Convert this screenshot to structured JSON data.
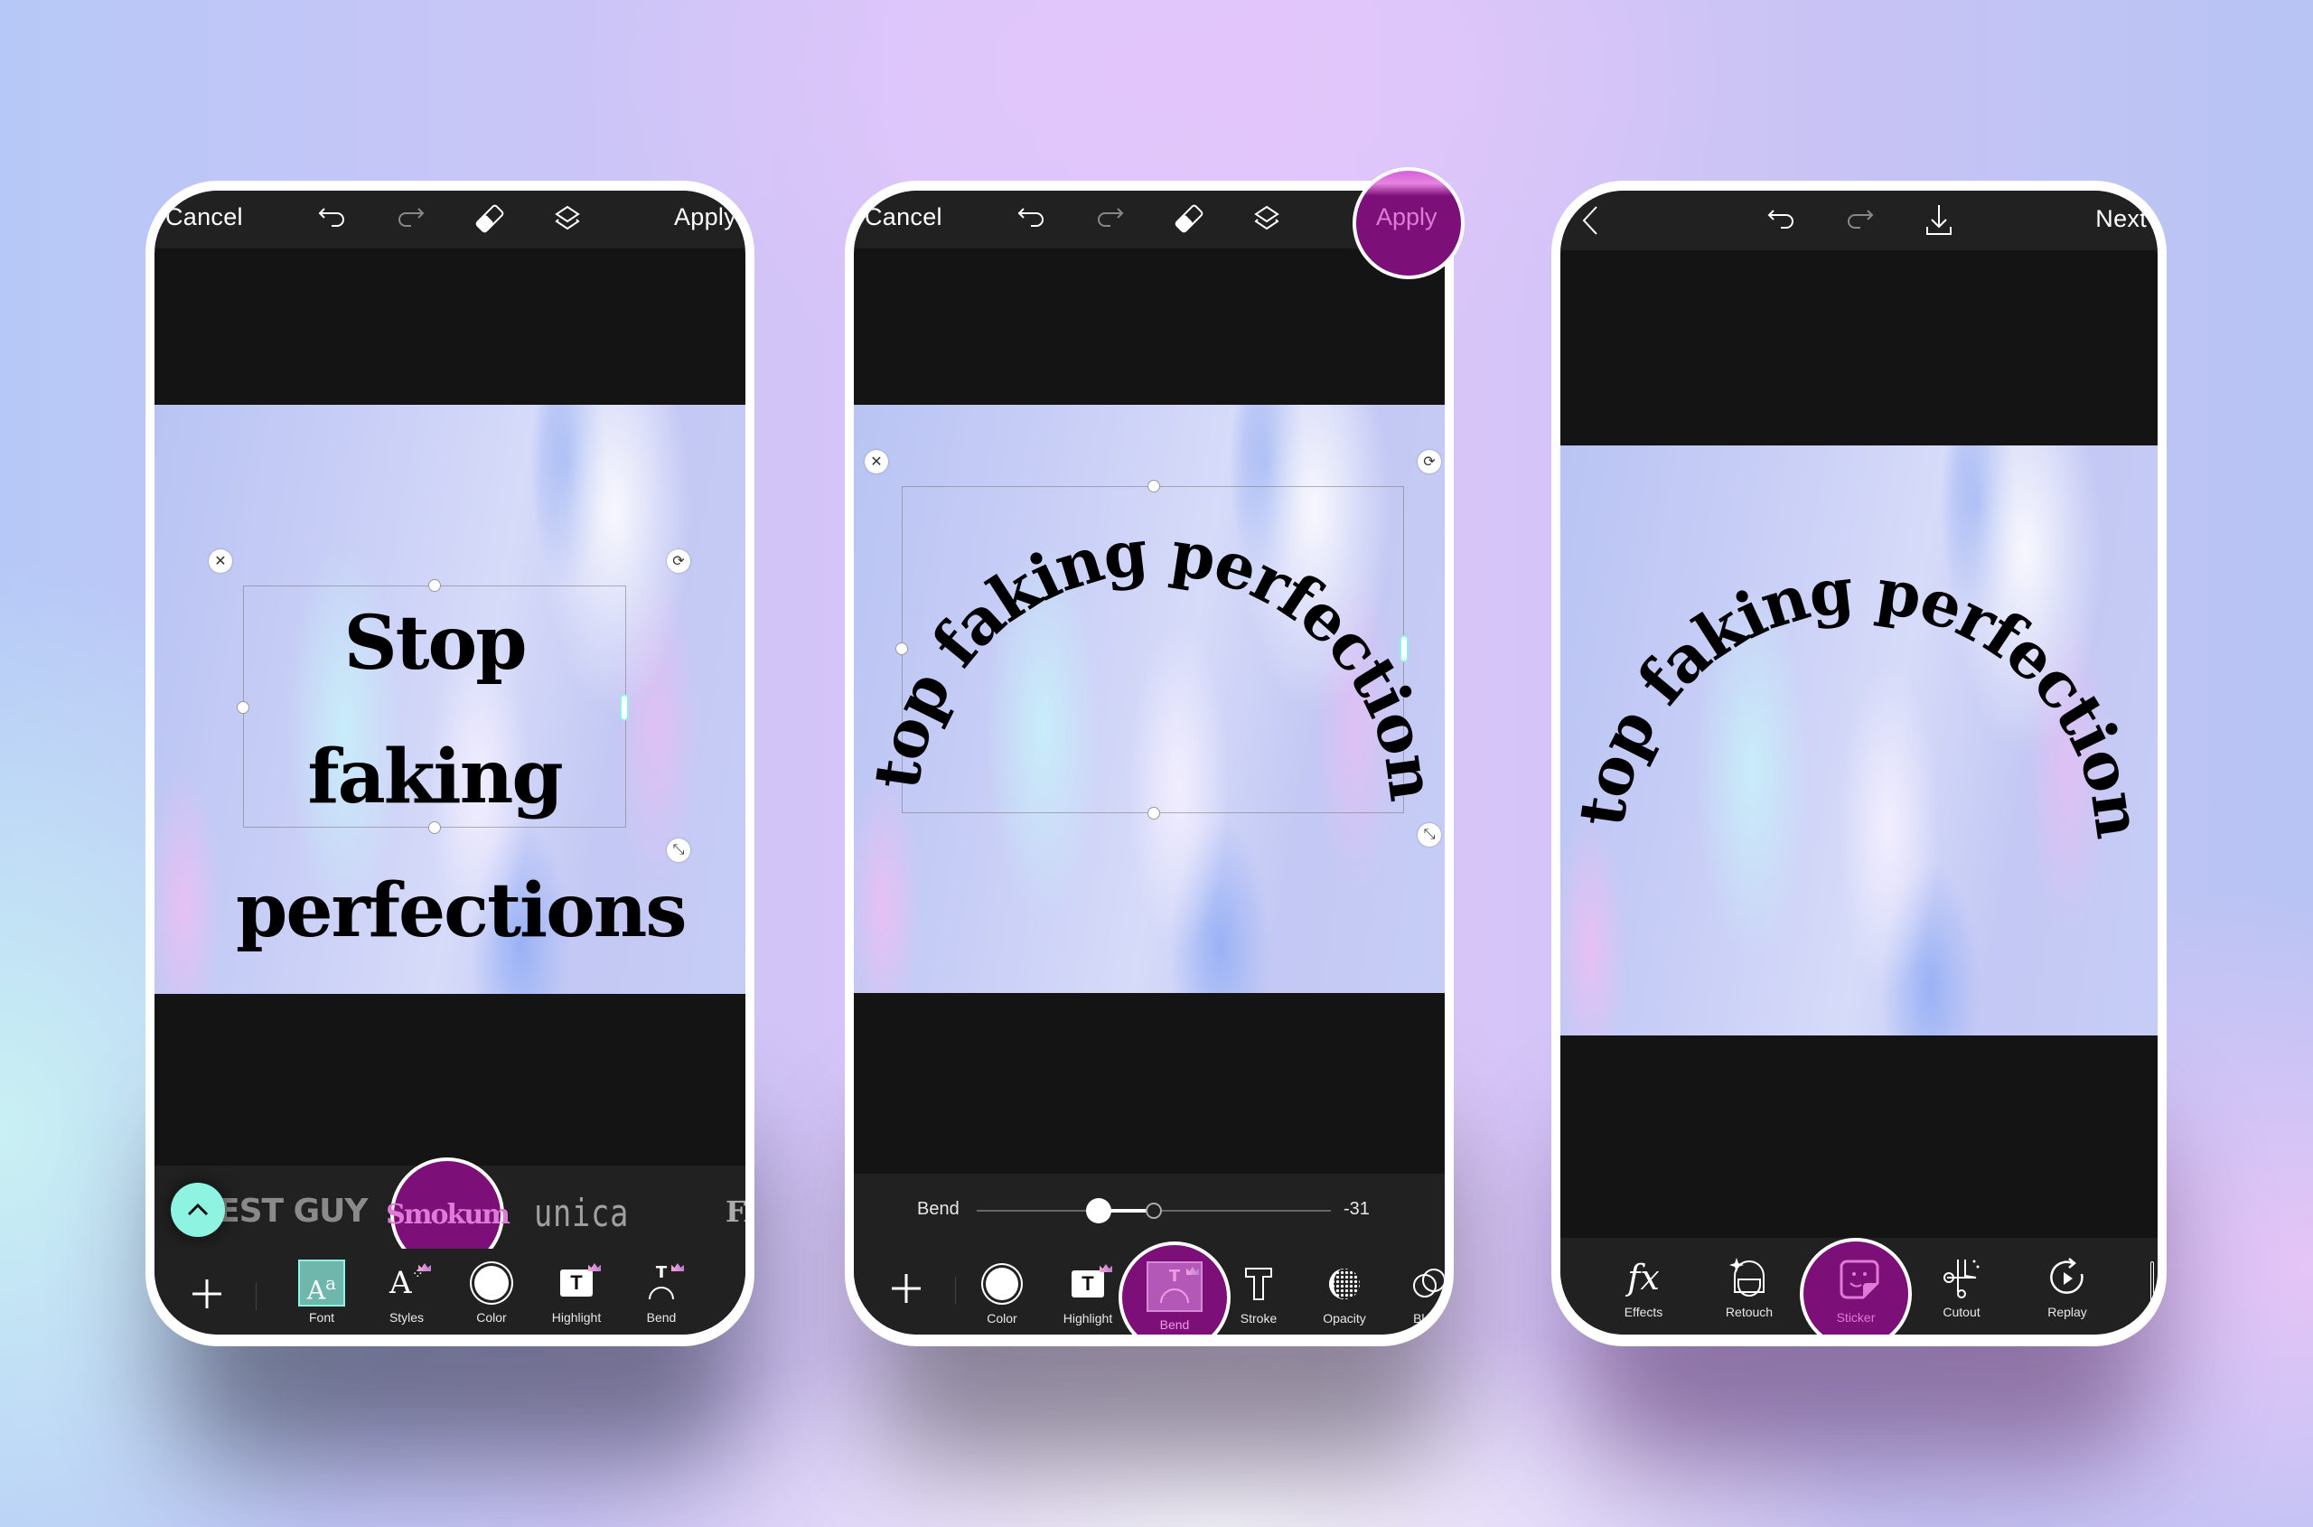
{
  "colors": {
    "accent_purple": "#7c0f78",
    "accent_pink": "#e07ad8",
    "accent_teal": "#8ff3e2",
    "toolbar_bg": "#212121",
    "screen_bg": "#141414"
  },
  "canvas_text": {
    "line1": "Stop faking",
    "line2": "perfections",
    "full": "Stop faking perfections"
  },
  "phone1": {
    "header": {
      "cancel": "Cancel",
      "apply": "Apply",
      "icons": [
        "undo-icon",
        "redo-icon",
        "eraser-icon",
        "layers-icon"
      ]
    },
    "fonts": [
      "EST GUY",
      "Smokum",
      "unica one",
      "FA"
    ],
    "selected_font": "Smokum",
    "tools": [
      {
        "label": "Font",
        "icon": "font-icon",
        "active": true
      },
      {
        "label": "Styles",
        "icon": "styles-icon",
        "premium": true
      },
      {
        "label": "Color",
        "icon": "color-icon"
      },
      {
        "label": "Highlight",
        "icon": "highlight-icon",
        "premium": true
      },
      {
        "label": "Bend",
        "icon": "bend-icon",
        "premium": true
      }
    ]
  },
  "phone2": {
    "header": {
      "cancel": "Cancel",
      "apply": "Apply"
    },
    "slider": {
      "label": "Bend",
      "value": "-31",
      "min": -100,
      "max": 100,
      "current": -31
    },
    "tools": [
      {
        "label": "Color",
        "icon": "color-icon"
      },
      {
        "label": "Highlight",
        "icon": "highlight-icon",
        "premium": true
      },
      {
        "label": "Bend",
        "icon": "bend-icon",
        "premium": true,
        "active": true
      },
      {
        "label": "Stroke",
        "icon": "stroke-icon"
      },
      {
        "label": "Opacity",
        "icon": "opacity-icon"
      },
      {
        "label": "Blend",
        "icon": "blend-icon"
      }
    ]
  },
  "phone3": {
    "header": {
      "next": "Next",
      "icons": [
        "back-icon",
        "undo-icon",
        "redo-icon",
        "download-icon"
      ]
    },
    "tools": [
      {
        "label": "Effects",
        "icon": "effects-icon"
      },
      {
        "label": "Retouch",
        "icon": "retouch-icon"
      },
      {
        "label": "Sticker",
        "icon": "sticker-icon",
        "active": true
      },
      {
        "label": "Cutout",
        "icon": "cutout-icon"
      },
      {
        "label": "Replay",
        "icon": "replay-icon"
      }
    ]
  }
}
